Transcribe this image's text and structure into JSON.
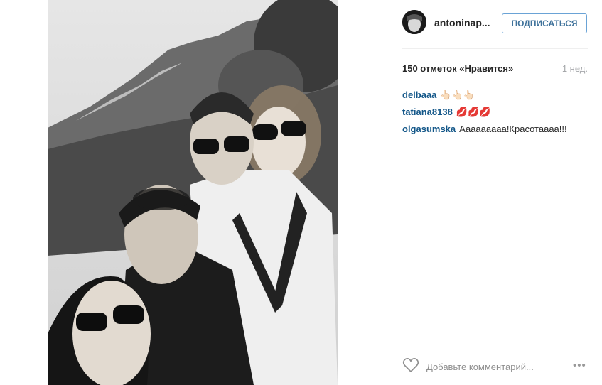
{
  "post": {
    "username": "antoninap...",
    "follow_label": "ПОДПИСАТЬСЯ",
    "likes_text": "150 отметок «Нравится»",
    "age": "1 нед."
  },
  "comments": [
    {
      "user": "delbaaa",
      "text": "👆🏻👆🏻👆🏻"
    },
    {
      "user": "tatiana8138",
      "text": "💋💋💋"
    },
    {
      "user": "olgasumska",
      "text": "Ааааааааа!Красотаааа!!!"
    }
  ],
  "footer": {
    "placeholder": "Добавьте комментарий...",
    "more_label": "•••"
  },
  "icons": {
    "heart": "heart-outline-icon",
    "more": "more-options-icon"
  },
  "colors": {
    "username_link": "#125688",
    "follow_text": "#3f729b",
    "muted": "#a5a7aa"
  }
}
